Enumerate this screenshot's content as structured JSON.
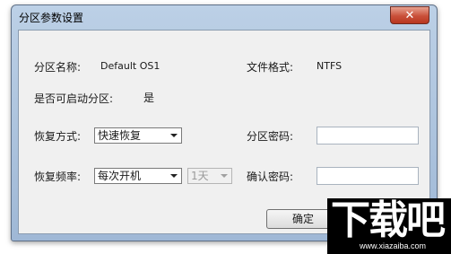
{
  "window": {
    "title": "分区参数设置"
  },
  "partition_name": {
    "label": "分区名称:",
    "value": "Default OS1"
  },
  "file_format": {
    "label": "文件格式:",
    "value": "NTFS"
  },
  "bootable": {
    "label": "是否可启动分区:",
    "value": "是"
  },
  "restore_mode": {
    "label": "恢复方式:",
    "selected": "快速恢复"
  },
  "partition_password": {
    "label": "分区密码:",
    "value": ""
  },
  "restore_frequency": {
    "label": "恢复频率:",
    "selected": "每次开机",
    "interval": "1天"
  },
  "confirm_password": {
    "label": "确认密码:",
    "value": ""
  },
  "buttons": {
    "ok": "确定"
  },
  "watermark": {
    "big": "下载吧",
    "small": "www.xiazaiba.com"
  }
}
